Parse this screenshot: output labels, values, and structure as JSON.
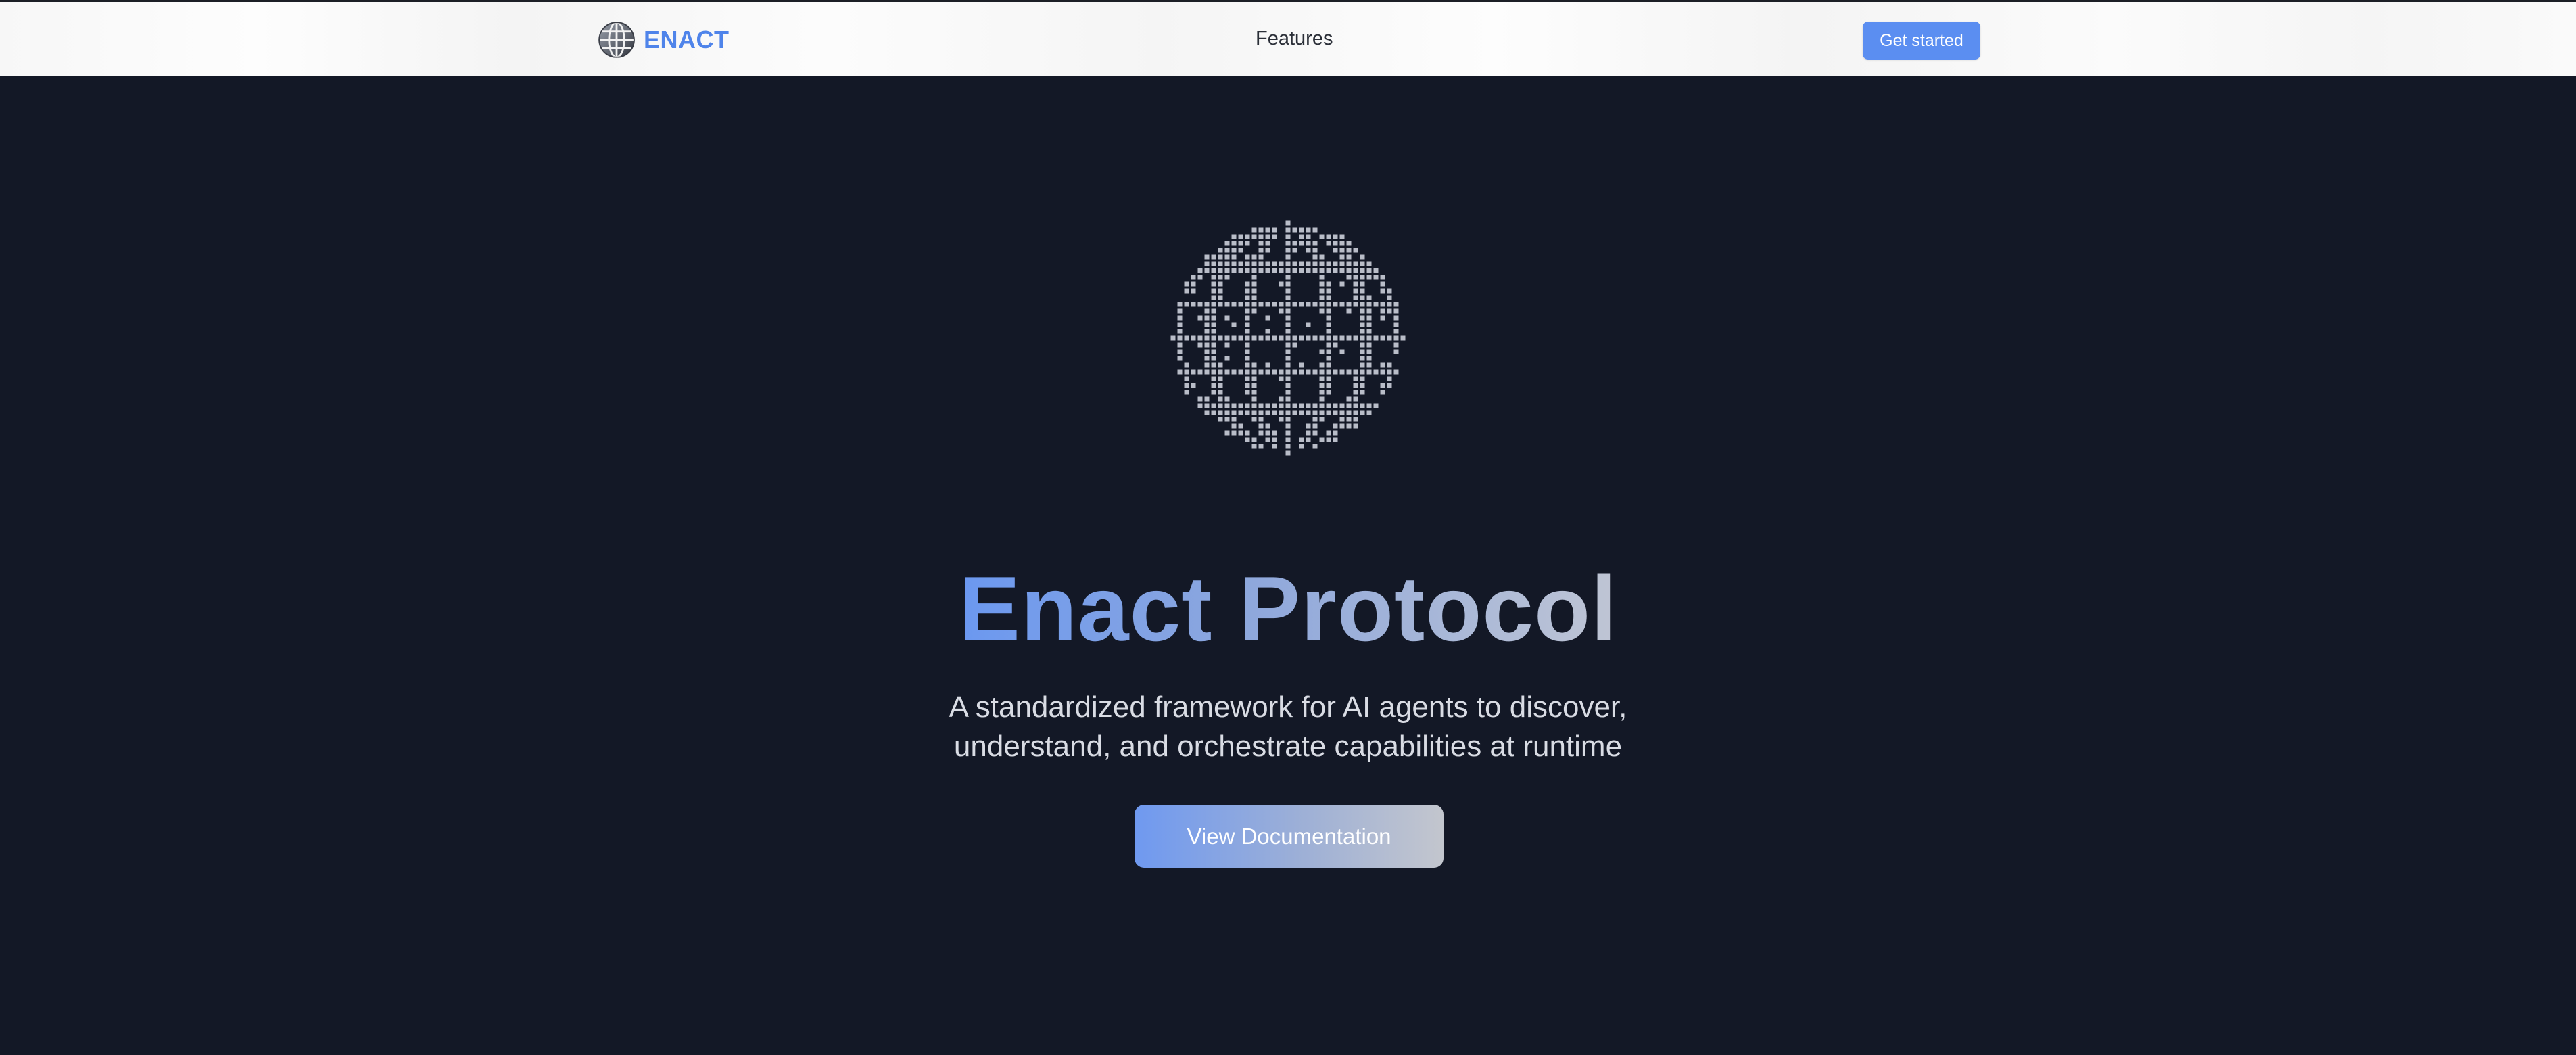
{
  "nav": {
    "brand_name": "ENACT",
    "brand_logo_icon": "pixel-globe-icon",
    "links": [
      {
        "label": "Features"
      }
    ],
    "cta_label": "Get started"
  },
  "hero": {
    "graphic_icon": "pixel-globe-icon",
    "title": "Enact Protocol",
    "subtitle_lines": [
      "A standardized framework for AI agents to discover,",
      "understand, and orchestrate capabilities at runtime"
    ],
    "cta_label": "View Documentation"
  },
  "colors": {
    "page_background": "#131826",
    "brand_blue": "#4f84ea",
    "button_blue": "#5b8ef1",
    "gradient_start": "#6b98f0",
    "gradient_end": "#c3c6ce",
    "globe_gray": "#b9bdc8"
  }
}
